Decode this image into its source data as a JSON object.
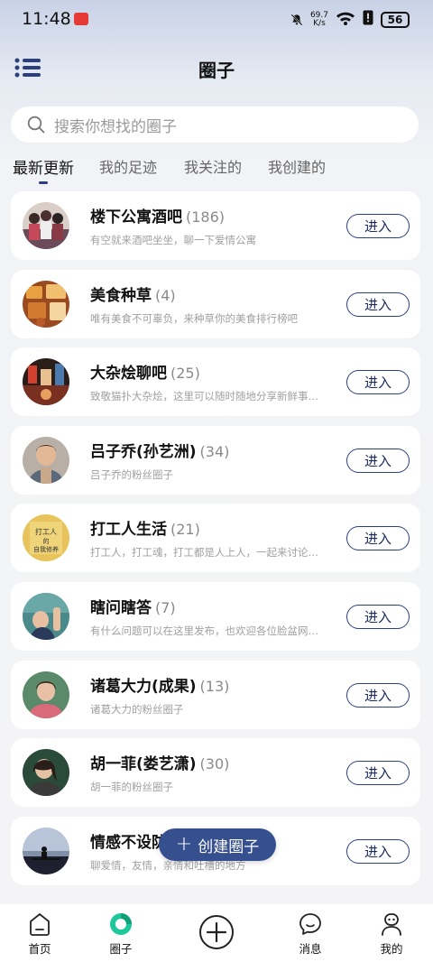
{
  "status_bar": {
    "time": "11:48",
    "net_speed_value": "69.7",
    "net_speed_unit": "K/s",
    "battery": "56"
  },
  "header": {
    "title": "圈子"
  },
  "search": {
    "placeholder": "搜索你想找的圈子"
  },
  "tabs": [
    {
      "label": "最新更新",
      "active": true
    },
    {
      "label": "我的足迹",
      "active": false
    },
    {
      "label": "我关注的",
      "active": false
    },
    {
      "label": "我创建的",
      "active": false
    }
  ],
  "circles": [
    {
      "name": "楼下公寓酒吧",
      "count": "(186)",
      "desc": "有空就来酒吧坐坐，聊一下爱情公寓",
      "button": "进入"
    },
    {
      "name": "美食种草",
      "count": "(4)",
      "desc": "唯有美食不可辜负，来种草你的美食排行榜吧",
      "button": "进入"
    },
    {
      "name": "大杂烩聊吧",
      "count": "(25)",
      "desc": "致敬猫扑大杂烩，这里可以随时随地分享新鲜事…",
      "button": "进入"
    },
    {
      "name": "吕子乔(孙艺洲)",
      "count": "(34)",
      "desc": "吕子乔的粉丝圈子",
      "button": "进入"
    },
    {
      "name": "打工人生活",
      "count": "(21)",
      "desc": "打工人，打工魂，打工都是人上人，一起来讨论…",
      "button": "进入"
    },
    {
      "name": "瞎问瞎答",
      "count": "(7)",
      "desc": "有什么问题可以在这里发布，也欢迎各位脸盆网…",
      "button": "进入"
    },
    {
      "name": "诸葛大力(成果)",
      "count": "(13)",
      "desc": "诸葛大力的粉丝圈子",
      "button": "进入"
    },
    {
      "name": "胡一菲(娄艺潇)",
      "count": "(30)",
      "desc": "胡一菲的粉丝圈子",
      "button": "进入"
    },
    {
      "name": "情感不设防",
      "count": "",
      "desc": "聊爱情，友情，亲情和吐槽的地方",
      "button": "进入"
    }
  ],
  "avatar_book_text": "打工人的自我修养",
  "create_button": {
    "label": "创建圈子"
  },
  "bottom_nav": [
    {
      "label": "首页"
    },
    {
      "label": "圈子"
    },
    {
      "label": ""
    },
    {
      "label": "消息"
    },
    {
      "label": "我的"
    }
  ],
  "colors": {
    "accent": "#2b3f7e",
    "fab": "#364f8f",
    "circle_tab_green": "#1fc79a"
  }
}
